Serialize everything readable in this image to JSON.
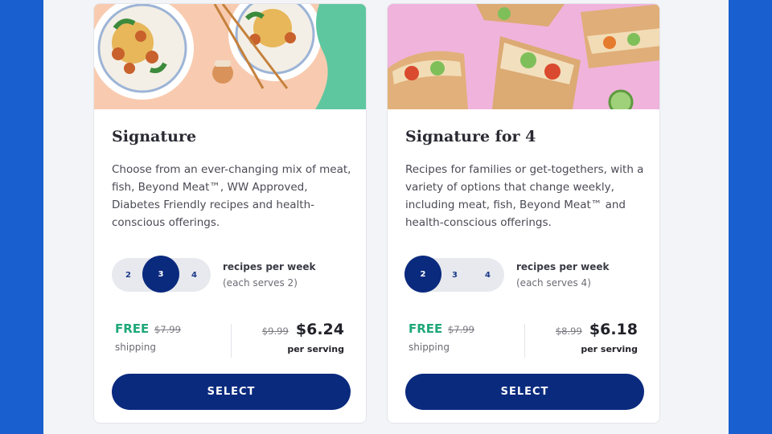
{
  "colors": {
    "outer_background": "#1a5fd0",
    "page_background": "#f3f4f7",
    "primary": "#0a2a7e",
    "free_green": "#1ea77a"
  },
  "cards": [
    {
      "title": "Signature",
      "description": "Choose from an ever-changing mix of meat, fish, Beyond Meat™, WW Approved, Diabetes Friendly recipes and health-conscious offerings.",
      "recipe_options": [
        "2",
        "3",
        "4"
      ],
      "selected_option": "3",
      "recipes_label": "recipes per week",
      "serves_label": "(each serves 2)",
      "shipping_free": "FREE",
      "shipping_old_price": "$7.99",
      "shipping_label": "shipping",
      "old_price": "$9.99",
      "price": "$6.24",
      "per_serving_label": "per serving",
      "button_label": "SELECT"
    },
    {
      "title": "Signature for 4",
      "description": "Recipes for families or get-togethers, with a variety of options that change weekly, including meat, fish, Beyond Meat™ and health-conscious offerings.",
      "recipe_options": [
        "2",
        "3",
        "4"
      ],
      "selected_option": "2",
      "recipes_label": "recipes per week",
      "serves_label": "(each serves 4)",
      "shipping_free": "FREE",
      "shipping_old_price": "$7.99",
      "shipping_label": "shipping",
      "old_price": "$8.99",
      "price": "$6.18",
      "per_serving_label": "per serving",
      "button_label": "SELECT"
    }
  ]
}
